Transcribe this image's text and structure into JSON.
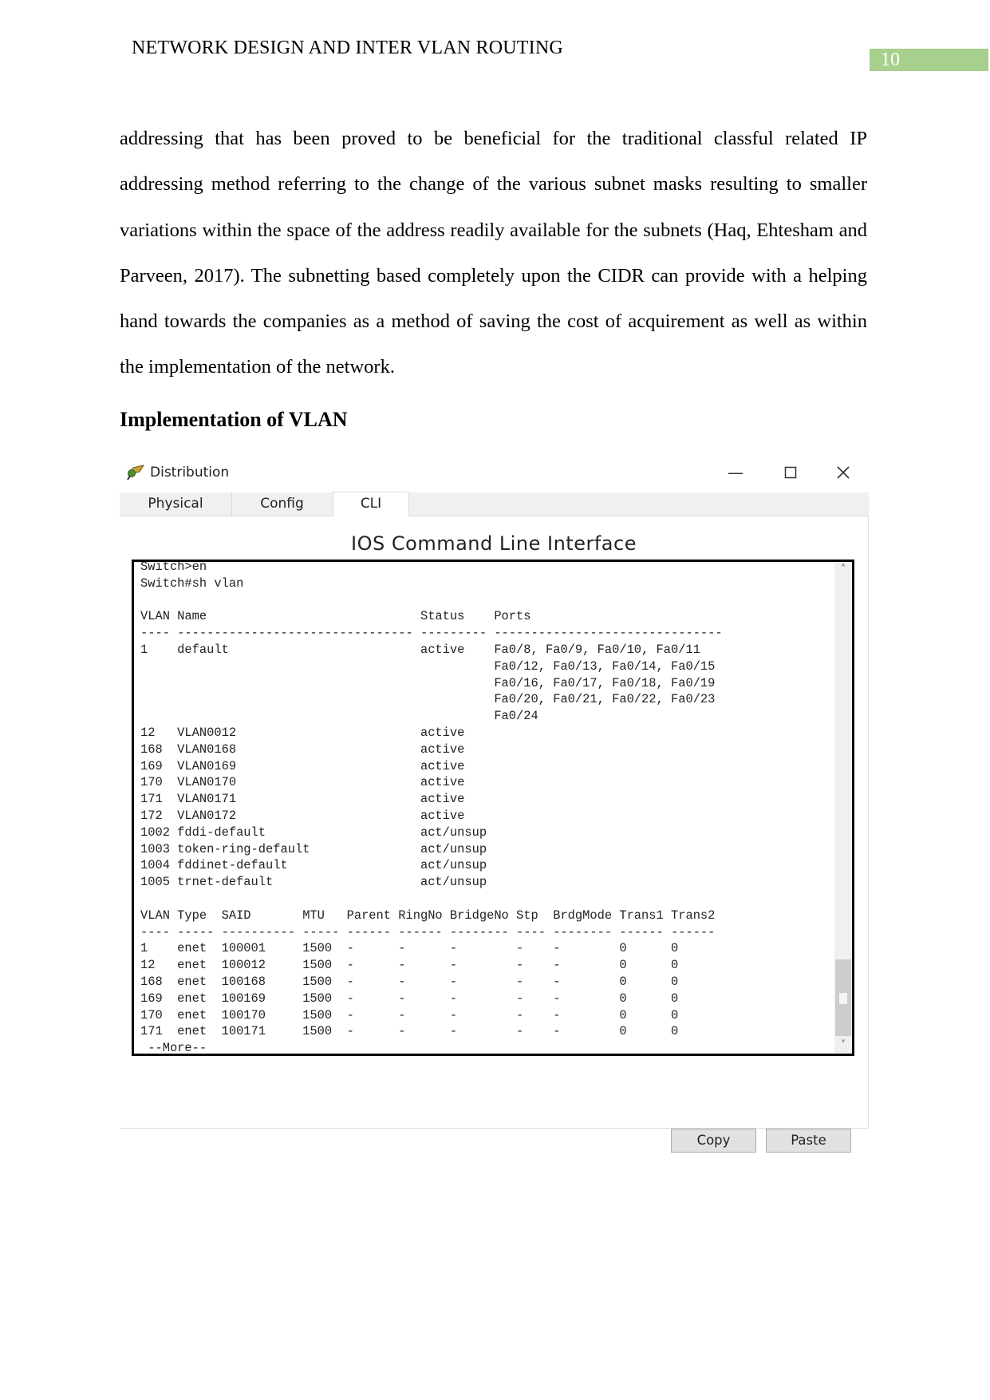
{
  "header": {
    "running_head": "NETWORK DESIGN AND INTER VLAN ROUTING",
    "page_number": "10",
    "page_number_bg": "#a8d08d"
  },
  "body": {
    "paragraph": "addressing that has been proved to be beneficial for the traditional classful related IP addressing method referring to the change of the various subnet masks resulting to smaller variations within the space of the address readily available for the subnets (Haq, Ehtesham and Parveen, 2017). The subnetting based completely upon the CIDR can provide with a helping hand towards the companies as a method of saving the cost of acquirement as well as within the implementation of the network.",
    "heading": "Implementation of VLAN"
  },
  "window": {
    "title": "Distribution",
    "icon": "switch-device-icon",
    "controls": {
      "minimize": "—",
      "maximize": "☐",
      "close": "✕"
    },
    "tabs": [
      {
        "label": "Physical",
        "active": false
      },
      {
        "label": "Config",
        "active": false
      },
      {
        "label": "CLI",
        "active": true
      }
    ],
    "cli_title": "IOS Command Line Interface",
    "buttons": {
      "copy": "Copy",
      "paste": "Paste"
    },
    "scrollbar": {
      "up": "˄",
      "down": "˅",
      "position_fraction": 0.92
    }
  },
  "terminal": {
    "commands": [
      "Switch>en",
      "Switch#sh vlan"
    ],
    "vlan_table": {
      "headers": [
        "VLAN",
        "Name",
        "Status",
        "Ports"
      ],
      "rows": [
        {
          "vlan": "1",
          "name": "default",
          "status": "active",
          "ports": [
            "Fa0/8, Fa0/9, Fa0/10, Fa0/11",
            "Fa0/12, Fa0/13, Fa0/14, Fa0/15",
            "Fa0/16, Fa0/17, Fa0/18, Fa0/19",
            "Fa0/20, Fa0/21, Fa0/22, Fa0/23",
            "Fa0/24"
          ]
        },
        {
          "vlan": "12",
          "name": "VLAN0012",
          "status": "active",
          "ports": []
        },
        {
          "vlan": "168",
          "name": "VLAN0168",
          "status": "active",
          "ports": []
        },
        {
          "vlan": "169",
          "name": "VLAN0169",
          "status": "active",
          "ports": []
        },
        {
          "vlan": "170",
          "name": "VLAN0170",
          "status": "active",
          "ports": []
        },
        {
          "vlan": "171",
          "name": "VLAN0171",
          "status": "active",
          "ports": []
        },
        {
          "vlan": "172",
          "name": "VLAN0172",
          "status": "active",
          "ports": []
        },
        {
          "vlan": "1002",
          "name": "fddi-default",
          "status": "act/unsup",
          "ports": []
        },
        {
          "vlan": "1003",
          "name": "token-ring-default",
          "status": "act/unsup",
          "ports": []
        },
        {
          "vlan": "1004",
          "name": "fddinet-default",
          "status": "act/unsup",
          "ports": []
        },
        {
          "vlan": "1005",
          "name": "trnet-default",
          "status": "act/unsup",
          "ports": []
        }
      ]
    },
    "type_table": {
      "headers": [
        "VLAN",
        "Type",
        "SAID",
        "MTU",
        "Parent",
        "RingNo",
        "BridgeNo",
        "Stp",
        "BrdgMode",
        "Trans1",
        "Trans2"
      ],
      "rows": [
        [
          "1",
          "enet",
          "100001",
          "1500",
          "-",
          "-",
          "-",
          "-",
          "-",
          "0",
          "0"
        ],
        [
          "12",
          "enet",
          "100012",
          "1500",
          "-",
          "-",
          "-",
          "-",
          "-",
          "0",
          "0"
        ],
        [
          "168",
          "enet",
          "100168",
          "1500",
          "-",
          "-",
          "-",
          "-",
          "-",
          "0",
          "0"
        ],
        [
          "169",
          "enet",
          "100169",
          "1500",
          "-",
          "-",
          "-",
          "-",
          "-",
          "0",
          "0"
        ],
        [
          "170",
          "enet",
          "100170",
          "1500",
          "-",
          "-",
          "-",
          "-",
          "-",
          "0",
          "0"
        ],
        [
          "171",
          "enet",
          "100171",
          "1500",
          "-",
          "-",
          "-",
          "-",
          "-",
          "0",
          "0"
        ]
      ]
    },
    "more_prompt": " --More--"
  }
}
